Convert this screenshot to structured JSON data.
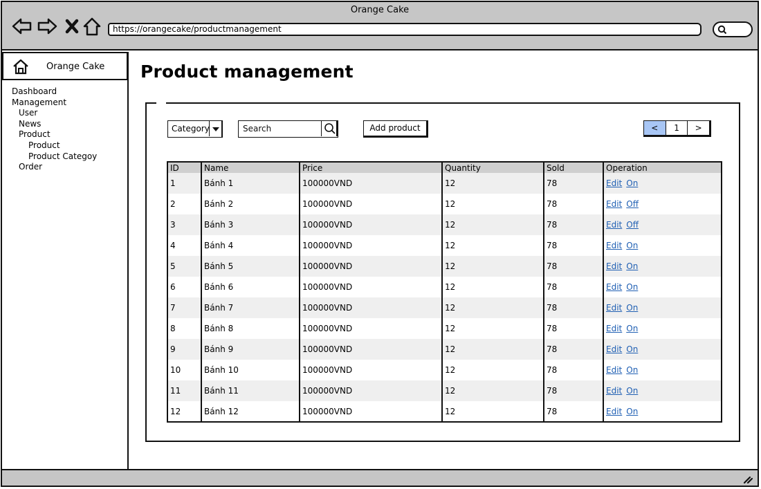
{
  "window": {
    "title": "Orange Cake"
  },
  "browser": {
    "url": "https://orangecake/productmanagement",
    "icons": [
      "back-arrow-icon",
      "forward-arrow-icon",
      "close-icon",
      "home-icon",
      "search-icon"
    ]
  },
  "sidebar": {
    "home_label": "Orange Cake",
    "items": [
      {
        "label": "Dashboard",
        "level": 0
      },
      {
        "label": "Management",
        "level": 0
      },
      {
        "label": "User",
        "level": 1
      },
      {
        "label": "News",
        "level": 1
      },
      {
        "label": "Product",
        "level": 1
      },
      {
        "label": "Product",
        "level": 2
      },
      {
        "label": "Product Categoy",
        "level": 2
      },
      {
        "label": "Order",
        "level": 1
      }
    ]
  },
  "main": {
    "title": "Product management",
    "toolbar": {
      "category_label": "Category",
      "search_text": "Search",
      "add_label": "Add product"
    },
    "pager": {
      "prev": "<",
      "page": "1",
      "next": ">"
    },
    "table": {
      "columns": [
        "ID",
        "Name",
        "Price",
        "Quantity",
        "Sold",
        "Operation"
      ],
      "rows": [
        {
          "id": "1",
          "name": "Bánh 1",
          "price": "100000VND",
          "qty": "12",
          "sold": "78",
          "edit": "Edit",
          "status": "On"
        },
        {
          "id": "2",
          "name": "Bánh 2",
          "price": "100000VND",
          "qty": "12",
          "sold": "78",
          "edit": "Edit",
          "status": "Off"
        },
        {
          "id": "3",
          "name": "Bánh 3",
          "price": "100000VND",
          "qty": "12",
          "sold": "78",
          "edit": "Edit",
          "status": "Off"
        },
        {
          "id": "4",
          "name": "Bánh 4",
          "price": "100000VND",
          "qty": "12",
          "sold": "78",
          "edit": "Edit",
          "status": "On"
        },
        {
          "id": "5",
          "name": "Bánh 5",
          "price": "100000VND",
          "qty": "12",
          "sold": "78",
          "edit": "Edit",
          "status": "On"
        },
        {
          "id": "6",
          "name": "Bánh 6",
          "price": "100000VND",
          "qty": "12",
          "sold": "78",
          "edit": "Edit",
          "status": "On"
        },
        {
          "id": "7",
          "name": "Bánh 7",
          "price": "100000VND",
          "qty": "12",
          "sold": "78",
          "edit": "Edit",
          "status": "On"
        },
        {
          "id": "8",
          "name": "Bánh 8",
          "price": "100000VND",
          "qty": "12",
          "sold": "78",
          "edit": "Edit",
          "status": "On"
        },
        {
          "id": "9",
          "name": "Bánh 9",
          "price": "100000VND",
          "qty": "12",
          "sold": "78",
          "edit": "Edit",
          "status": "On"
        },
        {
          "id": "10",
          "name": "Bánh 10",
          "price": "100000VND",
          "qty": "12",
          "sold": "78",
          "edit": "Edit",
          "status": "On"
        },
        {
          "id": "11",
          "name": "Bánh 11",
          "price": "100000VND",
          "qty": "12",
          "sold": "78",
          "edit": "Edit",
          "status": "On"
        },
        {
          "id": "12",
          "name": "Bánh 12",
          "price": "100000VND",
          "qty": "12",
          "sold": "78",
          "edit": "Edit",
          "status": "On"
        }
      ]
    }
  },
  "colors": {
    "chrome": "#c6c6c6",
    "table_header": "#cfcfcf",
    "row_stripe": "#efefef",
    "link": "#1f5fb3",
    "pager_active": "#a8c6f5"
  }
}
